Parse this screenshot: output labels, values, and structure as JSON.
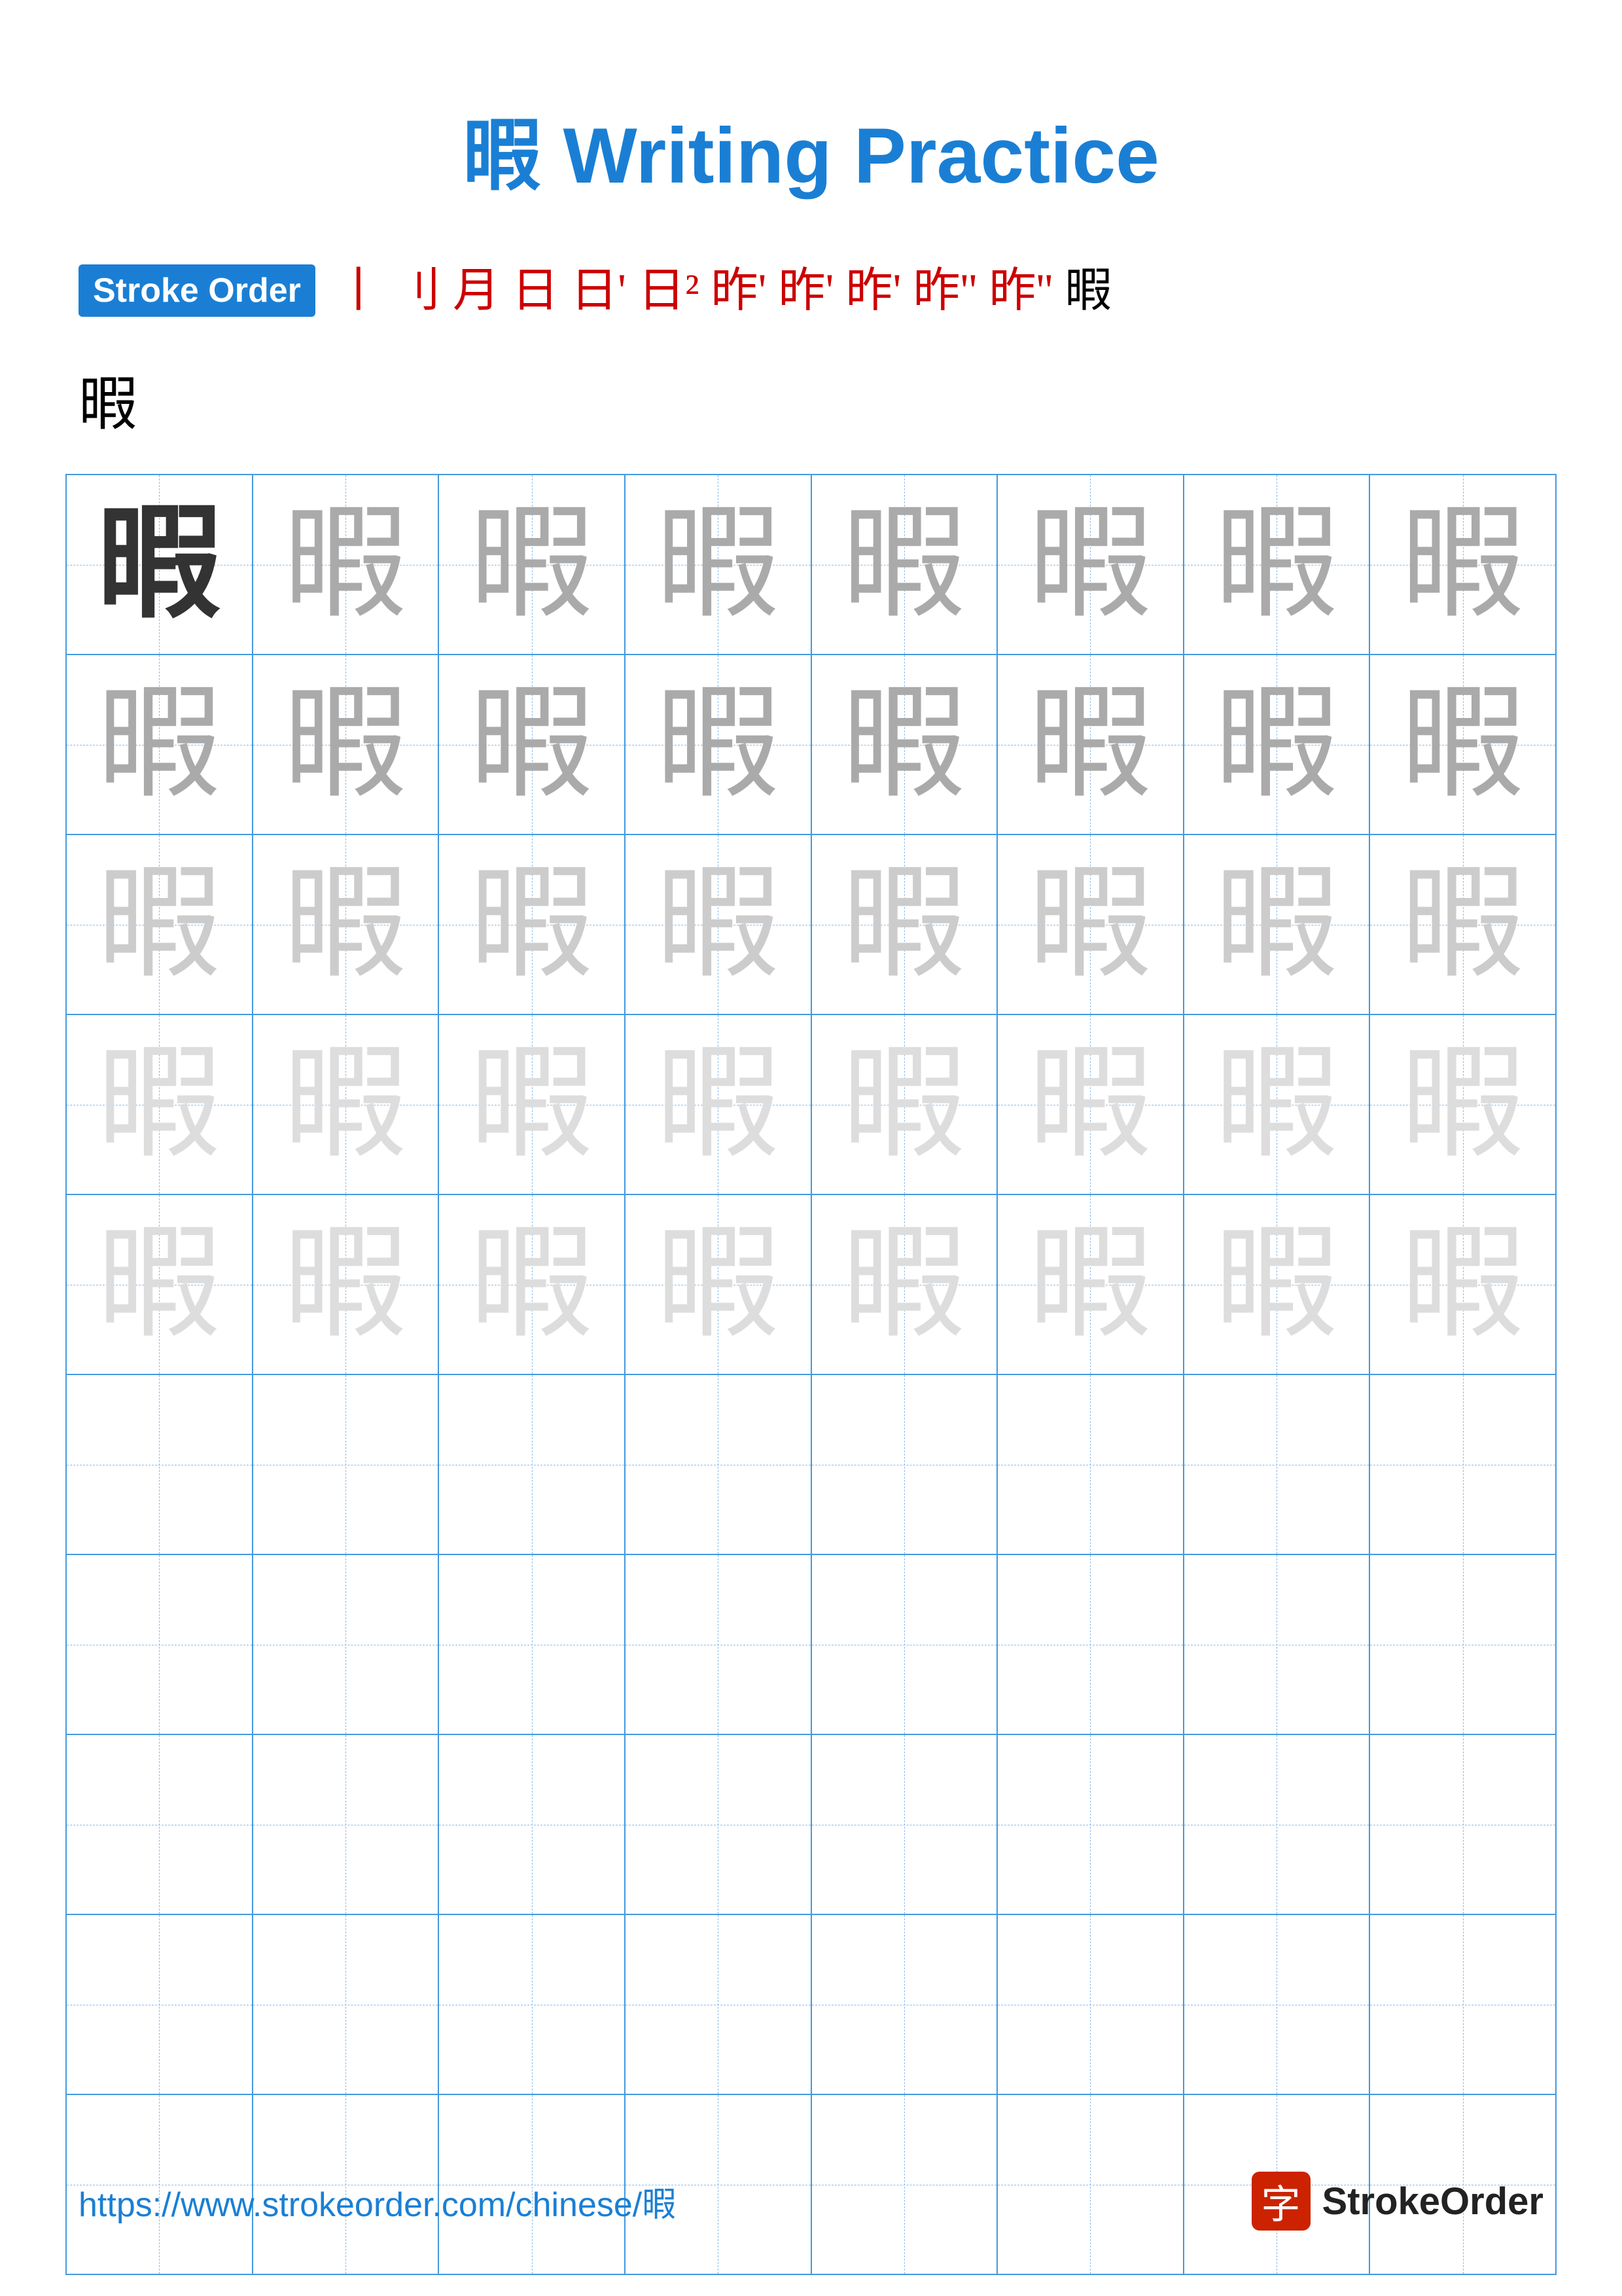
{
  "title": "暇 Writing Practice",
  "character": "暇",
  "stroke_order": {
    "badge_label": "Stroke Order",
    "strokes": [
      "丨",
      "刂",
      "月",
      "日",
      "日˙",
      "日˙",
      "昨",
      "昨",
      "昨",
      "昨˙",
      "昨˙",
      "暇"
    ],
    "bottom_char": "暇"
  },
  "grid": {
    "rows": 10,
    "cols": 8,
    "cells": [
      "dark",
      "medium",
      "medium",
      "medium",
      "medium",
      "medium",
      "medium",
      "medium",
      "medium",
      "medium",
      "medium",
      "medium",
      "medium",
      "medium",
      "medium",
      "medium",
      "light",
      "light",
      "light",
      "light",
      "light",
      "light",
      "light",
      "light",
      "lighter",
      "lighter",
      "lighter",
      "lighter",
      "lighter",
      "lighter",
      "lighter",
      "lighter",
      "lighter",
      "lighter",
      "lighter",
      "lighter",
      "lighter",
      "lighter",
      "lighter",
      "lighter",
      "empty",
      "empty",
      "empty",
      "empty",
      "empty",
      "empty",
      "empty",
      "empty",
      "empty",
      "empty",
      "empty",
      "empty",
      "empty",
      "empty",
      "empty",
      "empty",
      "empty",
      "empty",
      "empty",
      "empty",
      "empty",
      "empty",
      "empty",
      "empty",
      "empty",
      "empty",
      "empty",
      "empty",
      "empty",
      "empty",
      "empty",
      "empty",
      "empty",
      "empty",
      "empty",
      "empty",
      "empty",
      "empty",
      "empty",
      "empty"
    ]
  },
  "footer": {
    "url": "https://www.strokeorder.com/chinese/暇",
    "logo_char": "字",
    "logo_text": "StrokeOrder"
  }
}
